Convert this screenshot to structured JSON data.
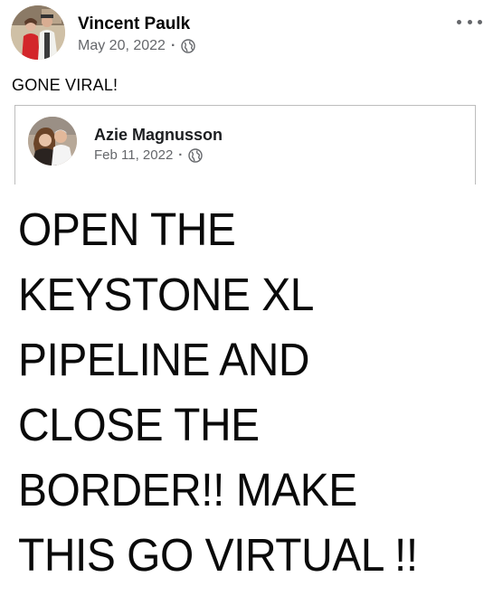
{
  "post": {
    "author": "Vincent Paulk",
    "date": "May 20, 2022",
    "separator": "·",
    "audience_icon": "globe-icon",
    "more_icon": "more-options-icon",
    "caption": "GONE VIRAL!"
  },
  "shared_post": {
    "author": "Azie Magnusson",
    "date": "Feb 11, 2022",
    "separator": "·",
    "audience_icon": "globe-icon",
    "message_lines": [
      "OPEN THE",
      "KEYSTONE XL",
      "PIPELINE AND",
      "CLOSE THE",
      "BORDER!! MAKE",
      "THIS GO VIRTUAL !!"
    ]
  },
  "colors": {
    "text_primary": "#050505",
    "text_secondary": "#65676b",
    "card_border": "#bdbdbd",
    "background": "#ffffff"
  }
}
